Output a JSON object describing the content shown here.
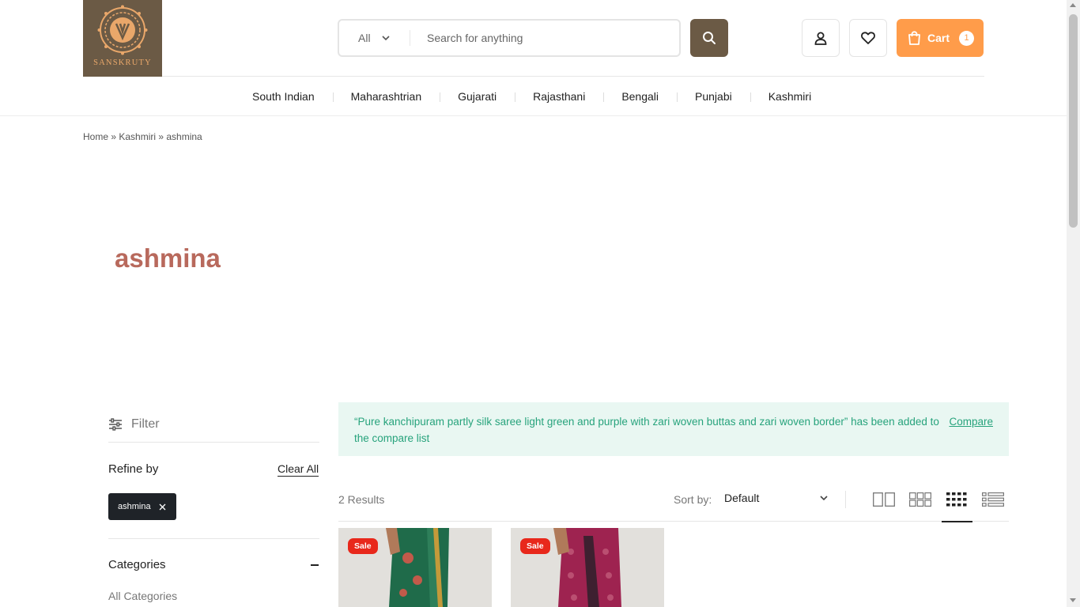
{
  "brand": {
    "logo_text": "SANSKRUTY"
  },
  "search": {
    "category": "All",
    "placeholder": "Search for anything"
  },
  "cart": {
    "label": "Cart",
    "count": "1"
  },
  "nav": {
    "items": [
      "South Indian",
      "Maharashtrian",
      "Gujarati",
      "Rajasthani",
      "Bengali",
      "Punjabi",
      "Kashmiri"
    ]
  },
  "breadcrumb": {
    "text": "Home » Kashmiri » ashmina"
  },
  "page": {
    "title": "ashmina"
  },
  "sidebar": {
    "filter_label": "Filter",
    "refine_label": "Refine by",
    "clear_all": "Clear All",
    "active_filter": "ashmina",
    "categories_label": "Categories",
    "all_categories": "All Categories"
  },
  "notice": {
    "message": "“Pure kanchipuram partly silk saree light green and purple with zari woven buttas and zari woven border” has been added to the compare list",
    "link": "Compare"
  },
  "toolbar": {
    "results": "2 Results",
    "sort_label": "Sort by:",
    "sort_value": "Default"
  },
  "products": [
    {
      "badge": "Sale",
      "color": "#1f6b4a"
    },
    {
      "badge": "Sale",
      "color": "#9e2350"
    }
  ],
  "colors": {
    "brand_brown": "#6b5a45",
    "cart_orange": "#ff9c4a",
    "title_color": "#b8695c",
    "notice_bg": "#e9f7f2",
    "notice_text": "#27a37c",
    "sale_red": "#e8281b"
  }
}
